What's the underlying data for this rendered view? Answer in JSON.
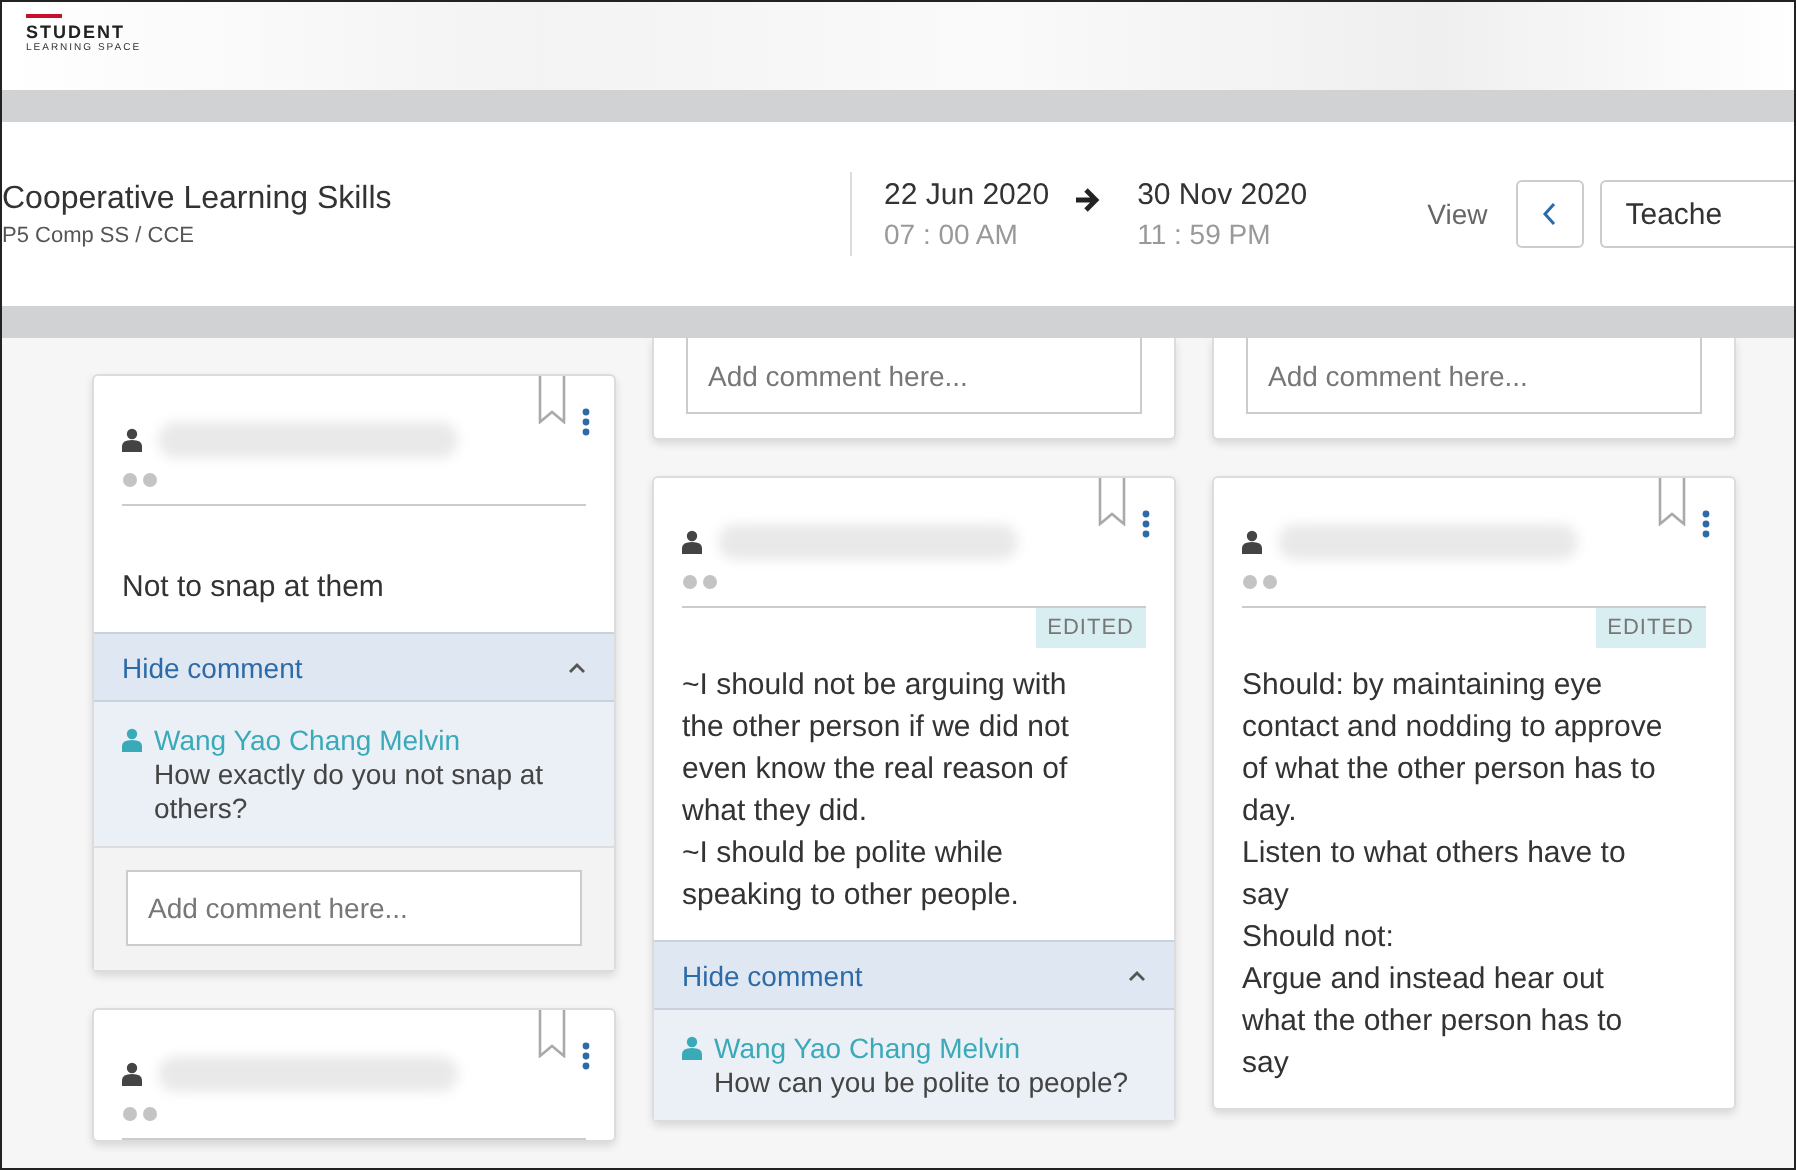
{
  "logo": {
    "title": "STUDENT",
    "subtitle": "LEARNING SPACE"
  },
  "lesson": {
    "title": "Cooperative Learning Skills",
    "subtitle": "P5 Comp SS / CCE"
  },
  "start": {
    "date": "22 Jun 2020",
    "time": "07 : 00 AM"
  },
  "end": {
    "date": "30 Nov 2020",
    "time": "11 : 59 PM"
  },
  "view": {
    "label": "View",
    "option": "Teache"
  },
  "columns": [
    {
      "cards": [
        {
          "kind": "response",
          "edited": false,
          "text": "Not to snap at them",
          "comments": {
            "expanded": true,
            "toggle": "Hide comment",
            "items": [
              {
                "author": "Wang Yao Chang Melvin",
                "text": "How exactly do you not snap at others?"
              }
            ]
          },
          "placeholder": "Add comment here..."
        },
        {
          "kind": "response",
          "edited": false
        }
      ]
    },
    {
      "cards": [
        {
          "kind": "tail",
          "placeholder": "Add comment here..."
        },
        {
          "kind": "response",
          "edited": true,
          "badge": "EDITED",
          "text": "~I should not be arguing with the other person if we did not even know the real reason of what they did.\n~I should be polite while speaking to other people.",
          "comments": {
            "expanded": true,
            "toggle": "Hide comment",
            "items": [
              {
                "author": "Wang Yao Chang Melvin",
                "text": "How can you be polite to people?"
              }
            ]
          }
        }
      ]
    },
    {
      "cards": [
        {
          "kind": "tail",
          "placeholder": "Add comment here..."
        },
        {
          "kind": "response",
          "edited": true,
          "badge": "EDITED",
          "text": "Should: by maintaining eye contact and nodding to approve of what the other person has to day.\nListen to what others have to say\nShould not:\nArgue and instead hear out what the other person has to say"
        }
      ]
    }
  ]
}
